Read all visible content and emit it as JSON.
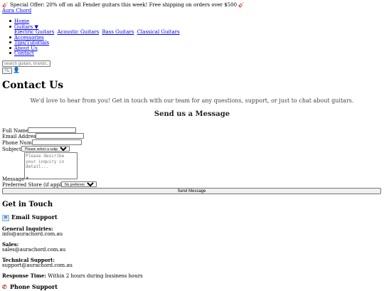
{
  "promo": {
    "text": "Special Offer: 20% off on all Fender guitars this week! Free shipping on orders over $500"
  },
  "brand": {
    "name": "Aura Chord"
  },
  "nav": {
    "home": "Home",
    "guitars": "Guitars ▼",
    "sub": [
      "Electric Guitars",
      "Acoustic Guitars",
      "Bass Guitars",
      "Classical Guitars"
    ],
    "accessories": "Accessories",
    "tips": "Tips/Tutorials",
    "about": "About Us",
    "contact": "Contact"
  },
  "search": {
    "placeholder": "Search guitars, brands..."
  },
  "page": {
    "title": "Contact Us",
    "intro": "We'd love to hear from you! Get in touch with our team for any questions, support, or just to chat about guitars."
  },
  "form": {
    "title": "Send us a Message",
    "full_name": "Full Name *",
    "email": "Email Address *",
    "phone": "Phone Number",
    "subject": "Subject *",
    "subject_selected": "Please select a subject",
    "message_placeholder": "Please describe your inquiry in detail...",
    "message": "Message *",
    "store": "Preferred Store (if applicable)",
    "store_selected": "No preference",
    "send": "Send Message"
  },
  "contact": {
    "title": "Get in Touch",
    "email_support": "Email Support",
    "general_label": "General Inquiries:",
    "general_value": "info@aurachord.com.au",
    "sales_label": "Sales:",
    "sales_value": "sales@aurachord.com.au",
    "tech_label": "Technical Support:",
    "tech_value": "support@aurachord.com.au",
    "response_label": "Response Time:",
    "response_value": "Within 2 hours during business hours",
    "phone_support": "Phone Support"
  },
  "icons": {
    "promo_left": "guitar-icon",
    "promo_right": "guitar-icon",
    "search_btn": "magnifier-icon",
    "user": "user-icon",
    "email": "envelope-icon",
    "phone": "phone-icon"
  }
}
